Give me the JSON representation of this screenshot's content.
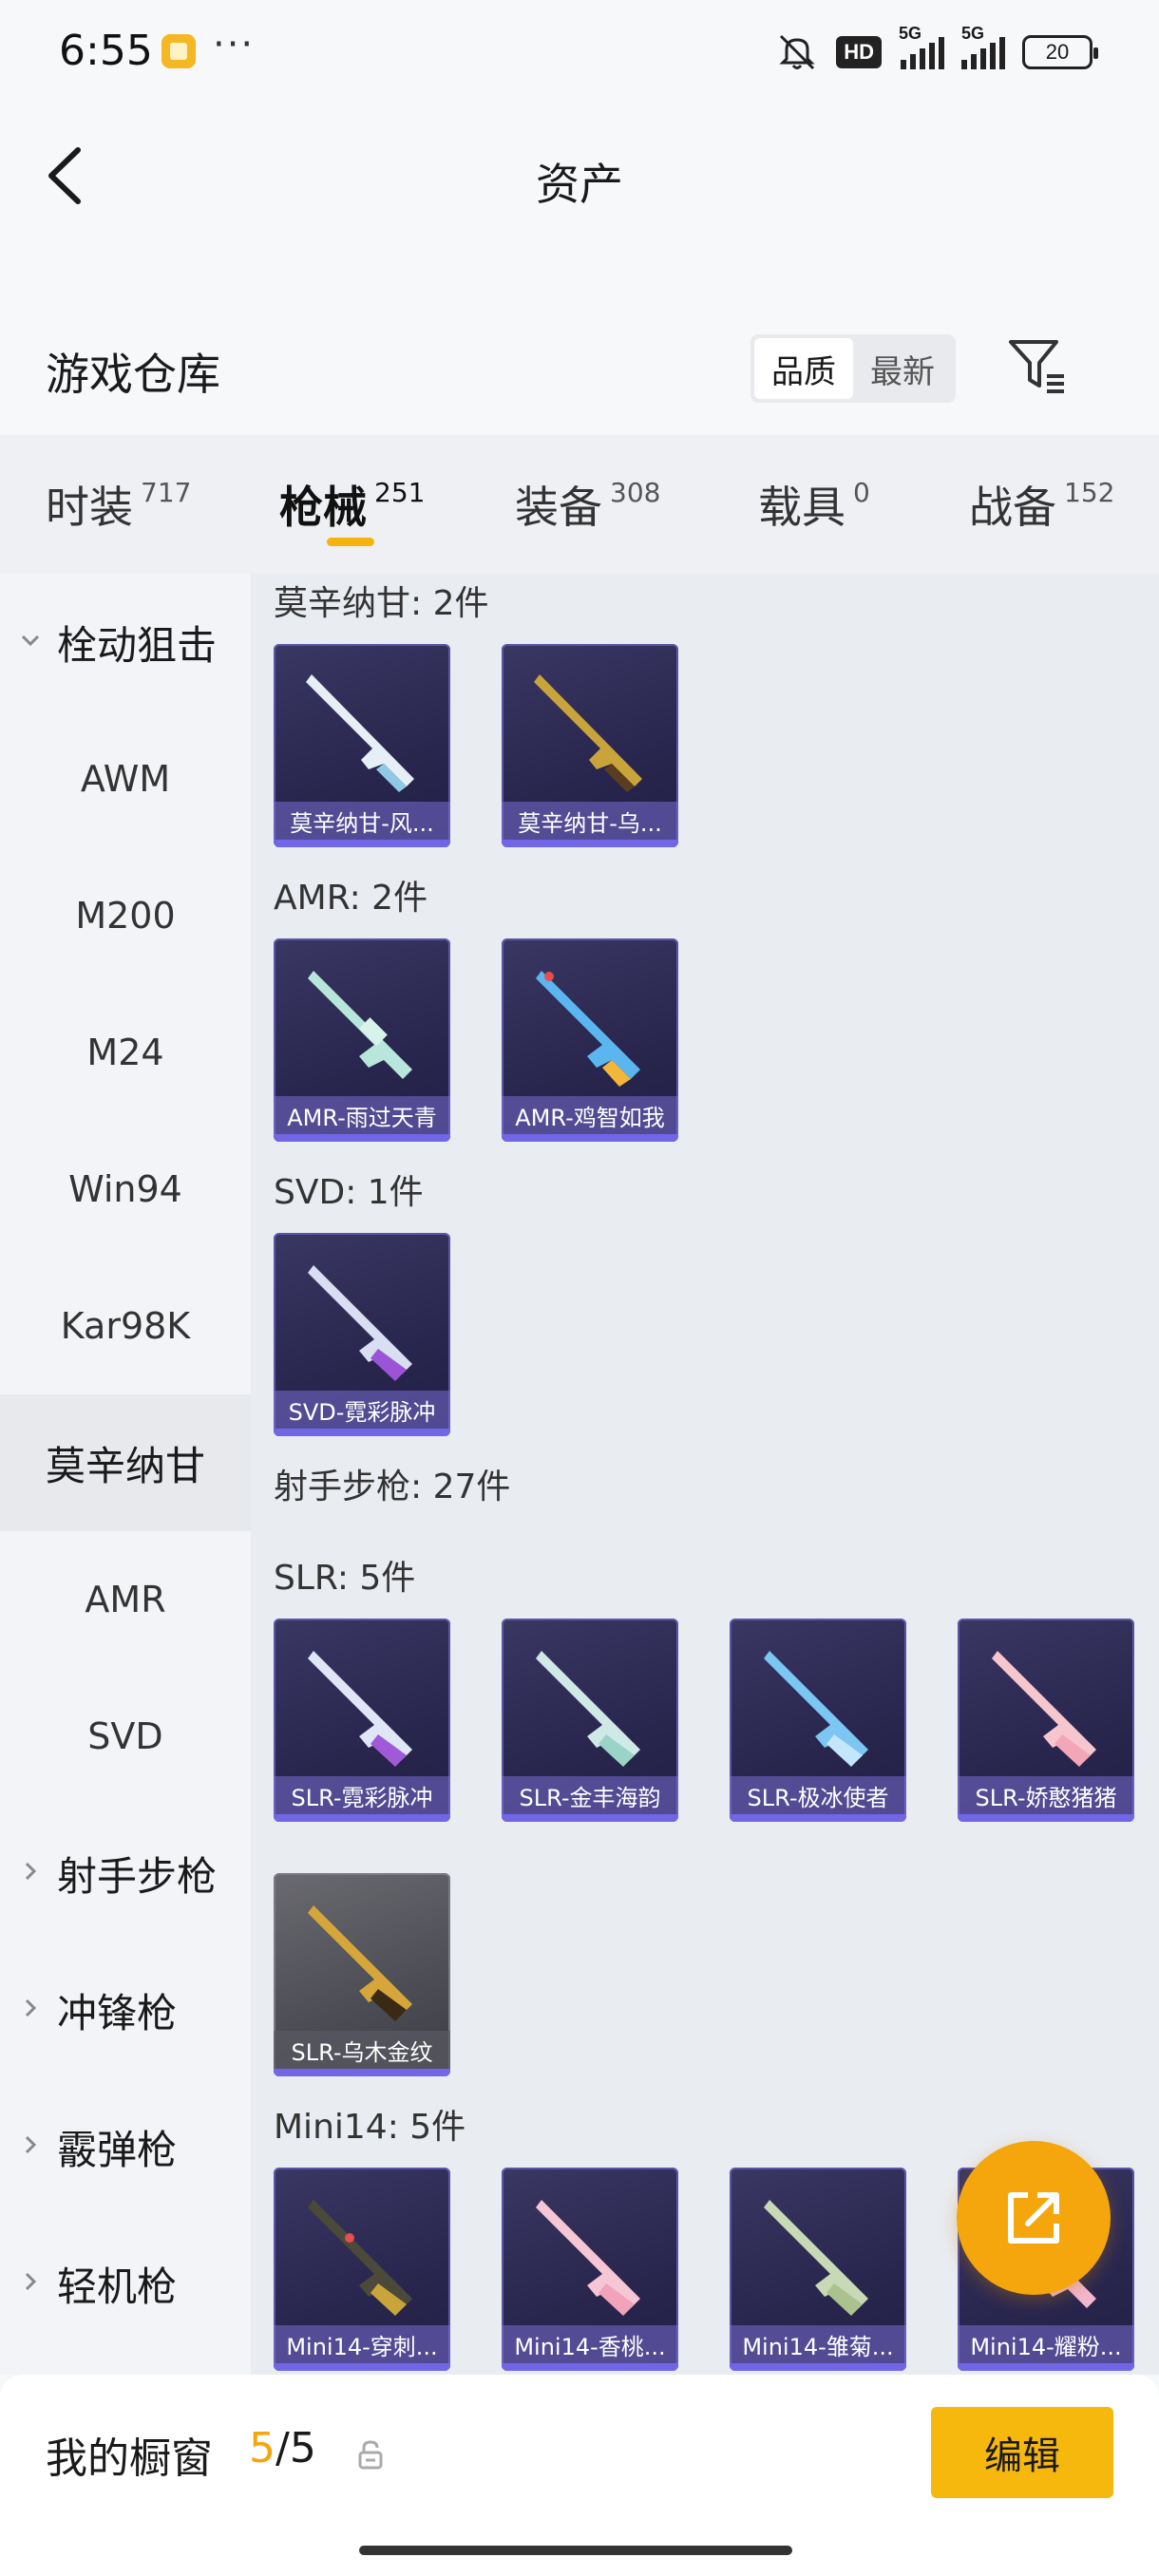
{
  "status_bar": {
    "time": "6:55",
    "dots": "···",
    "hd": "HD",
    "signal_1": "5G",
    "signal_2": "5G",
    "battery": "20"
  },
  "nav": {
    "title": "资产"
  },
  "header": {
    "title": "游戏仓库",
    "sort_options": [
      "品质",
      "最新"
    ],
    "active_sort": "品质"
  },
  "tabs": [
    {
      "label": "时装",
      "count": "717"
    },
    {
      "label": "枪械",
      "count": "251",
      "active": true
    },
    {
      "label": "装备",
      "count": "308"
    },
    {
      "label": "载具",
      "count": "0"
    },
    {
      "label": "战备",
      "count": "152"
    }
  ],
  "sidebar": {
    "items": [
      {
        "label": "栓动狙击",
        "type": "group",
        "expanded": true
      },
      {
        "label": "AWM"
      },
      {
        "label": "M200"
      },
      {
        "label": "M24"
      },
      {
        "label": "Win94"
      },
      {
        "label": "Kar98K"
      },
      {
        "label": "莫辛纳甘",
        "selected": true
      },
      {
        "label": "AMR"
      },
      {
        "label": "SVD"
      },
      {
        "label": "射手步枪",
        "type": "group"
      },
      {
        "label": "冲锋枪",
        "type": "group"
      },
      {
        "label": "霰弹枪",
        "type": "group"
      },
      {
        "label": "轻机枪",
        "type": "group"
      }
    ]
  },
  "sections": {
    "mosin": {
      "title": "莫辛纳甘: 2件",
      "cards": [
        "莫辛纳甘-风...",
        "莫辛纳甘-乌..."
      ]
    },
    "amr": {
      "title": "AMR: 2件",
      "cards": [
        "AMR-雨过天青",
        "AMR-鸡智如我"
      ]
    },
    "svd": {
      "title": "SVD: 1件",
      "cards": [
        "SVD-霓彩脉冲"
      ]
    },
    "dmr_group": {
      "title": "射手步枪: 27件"
    },
    "slr": {
      "title": "SLR: 5件",
      "cards": [
        "SLR-霓彩脉冲",
        "SLR-金丰海韵",
        "SLR-极冰使者",
        "SLR-娇憨猪猪",
        "SLR-乌木金纹"
      ]
    },
    "mini14": {
      "title": "Mini14: 5件",
      "cards": [
        "Mini14-穿刺...",
        "Mini14-香桃...",
        "Mini14-雏菊...",
        "Mini14-耀粉..."
      ]
    }
  },
  "bottom_bar": {
    "label": "我的橱窗",
    "current": "5",
    "separator": "/",
    "total": "5",
    "edit_label": "编辑"
  },
  "colors": {
    "accent": "#f5a60c",
    "card_bg": "#2a2750",
    "card_border": "#7167e6"
  }
}
